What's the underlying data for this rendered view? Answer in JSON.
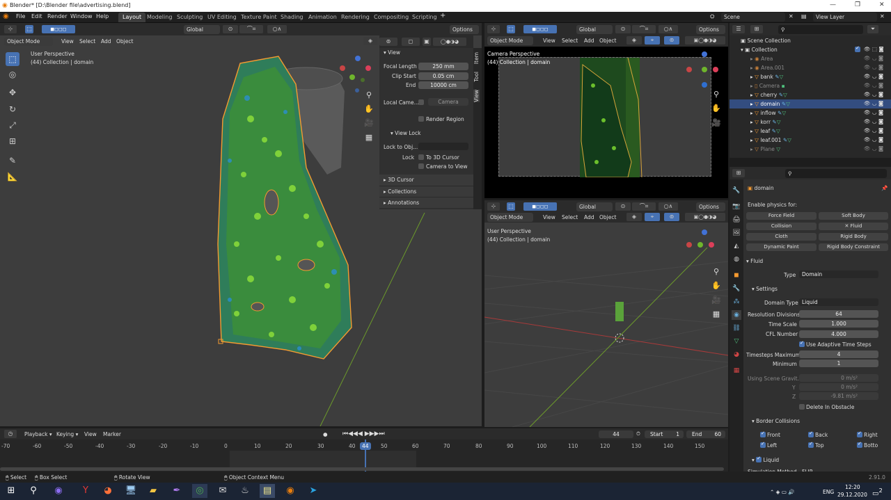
{
  "window": {
    "title": "Blender* [D:\\Blender file\\advertising.blend]",
    "min": "—",
    "max": "❐",
    "close": "✕"
  },
  "menus": [
    "File",
    "Edit",
    "Render",
    "Window",
    "Help"
  ],
  "workspaces": [
    "Layout",
    "Modeling",
    "Sculpting",
    "UV Editing",
    "Texture Paint",
    "Shading",
    "Animation",
    "Rendering",
    "Compositing",
    "Scripting"
  ],
  "plus": "+",
  "scene": {
    "label": "Scene",
    "view_layer": "View Layer"
  },
  "viewport_main": {
    "orientation": "Global",
    "options": "Options",
    "mode": "Object Mode",
    "menu": [
      "View",
      "Select",
      "Add",
      "Object"
    ],
    "persp": "User Perspective",
    "collection": "(44) Collection | domain"
  },
  "npanel": {
    "tabs": [
      "Item",
      "Tool",
      "View"
    ],
    "view_header": "View",
    "focal_label": "Focal Length",
    "focal": "250 mm",
    "clip_start_label": "Clip Start",
    "clip_start": "0.05 cm",
    "end_label": "End",
    "clip_end": "10000 cm",
    "local_camera_label": "Local Came...",
    "camera": "Camera",
    "render_region": "Render Region",
    "view_lock": "View Lock",
    "lock_to_obj": "Lock to Obj...",
    "lock": "Lock",
    "to_3d_cursor": "To 3D Cursor",
    "camera_to_view": "Camera to View",
    "sec_cursor": "3D Cursor",
    "sec_collections": "Collections",
    "sec_annotations": "Annotations"
  },
  "viewport_cam": {
    "orientation": "Global",
    "options": "Options",
    "mode": "Object Mode",
    "menu": [
      "View",
      "Select",
      "Add",
      "Object"
    ],
    "persp": "Camera Perspective",
    "collection": "(44) Collection | domain"
  },
  "viewport_user": {
    "orientation": "Global",
    "options": "Options",
    "mode": "Object Mode",
    "menu": [
      "View",
      "Select",
      "Add",
      "Object"
    ],
    "persp": "User Perspective",
    "collection": "(44) Collection | domain"
  },
  "outliner": {
    "scene_collection": "Scene Collection",
    "collection": "Collection",
    "items": [
      "Area",
      "Area.001",
      "bank",
      "Camera",
      "cherry",
      "domain",
      "inflow",
      "korr",
      "leaf",
      "leaf.001",
      "Plane"
    ]
  },
  "properties": {
    "object": "domain",
    "enable_physics": "Enable physics for:",
    "buttons": [
      "Force Field",
      "Soft Body",
      "Collision",
      "Fluid",
      "Cloth",
      "Rigid Body",
      "Dynamic Paint",
      "Rigid Body Constraint"
    ],
    "fluid": "Fluid",
    "type_label": "Type",
    "type": "Domain",
    "settings": "Settings",
    "domain_type_label": "Domain Type",
    "domain_type": "Liquid",
    "res_label": "Resolution Divisions",
    "res": "64",
    "time_scale_label": "Time Scale",
    "time_scale": "1.000",
    "cfl_label": "CFL Number",
    "cfl": "4.000",
    "adaptive": "Use Adaptive Time Steps",
    "ts_max_label": "Timesteps Maximum",
    "ts_max": "4",
    "min_label": "Minimum",
    "ts_min": "1",
    "gravity_label": "Using Scene Gravit...",
    "gx": "0 m/s²",
    "y_label": "Y",
    "gy": "0 m/s²",
    "z_label": "Z",
    "gz": "-9.81 m/s²",
    "delete_obstacle": "Delete In Obstacle",
    "border": "Border Collisions",
    "front": "Front",
    "back": "Back",
    "right": "Right",
    "left": "Left",
    "top": "Top",
    "bottom": "Botto",
    "liquid": "Liquid",
    "sim_method": "Simulation Method",
    "flip": "FLIP"
  },
  "timeline": {
    "playback": "Playback",
    "keying": "Keying",
    "view": "View",
    "marker": "Marker",
    "current": "44",
    "start_label": "Start",
    "start": "1",
    "end_label": "End",
    "end": "60",
    "ticks": [
      "-70",
      "-60",
      "-50",
      "-40",
      "-30",
      "-20",
      "-10",
      "0",
      "10",
      "20",
      "30",
      "40",
      "50",
      "60",
      "70",
      "80",
      "90",
      "100",
      "110",
      "120",
      "130",
      "140",
      "150"
    ]
  },
  "status": {
    "select": "Select",
    "box": "Box Select",
    "rotate": "Rotate View",
    "context": "Object Context Menu",
    "version": "2.91.0"
  },
  "taskbar": {
    "lang": "ENG",
    "time": "12:20",
    "date": "29.12.2020",
    "notif": "2"
  }
}
